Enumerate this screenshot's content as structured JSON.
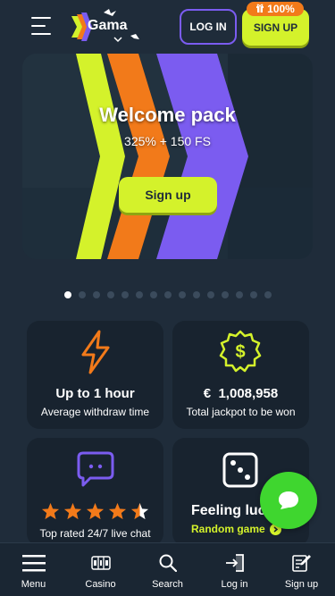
{
  "header": {
    "logo_text": "Gama",
    "login_label": "LOG IN",
    "signup_label": "SIGN UP",
    "badge_text": "100%",
    "colors": {
      "accent_lime": "#d4f22b",
      "accent_purple": "#7b5cf0",
      "accent_orange": "#f27a1a"
    }
  },
  "banner": {
    "title": "Welcome pack",
    "subtitle": "325% + 150 FS",
    "button_label": "Sign up"
  },
  "carousel": {
    "total": 15,
    "active": 0
  },
  "cards": [
    {
      "icon": "lightning-icon",
      "title": "Up to 1 hour",
      "desc": "Average withdraw time"
    },
    {
      "icon": "dollar-badge-icon",
      "currency": "€",
      "amount": "1,008,958",
      "desc": "Total jackpot to be won"
    },
    {
      "icon": "chat-bubble-icon",
      "rating": 4.5,
      "desc": "Top rated 24/7 live chat"
    },
    {
      "icon": "dice-icon",
      "title": "Feeling luc",
      "link": "Random game"
    }
  ],
  "chat": {
    "icon": "chat-icon",
    "color": "#3fd62f"
  },
  "bottom_nav": [
    {
      "icon": "menu-icon",
      "label": "Menu"
    },
    {
      "icon": "slots-icon",
      "label": "Casino"
    },
    {
      "icon": "search-icon",
      "label": "Search"
    },
    {
      "icon": "login-icon",
      "label": "Log in"
    },
    {
      "icon": "signup-icon",
      "label": "Sign up"
    }
  ]
}
